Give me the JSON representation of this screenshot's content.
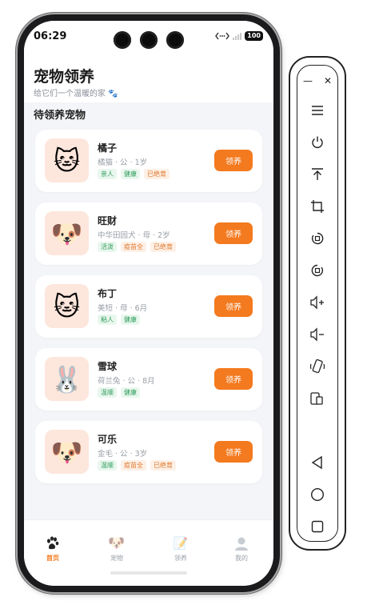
{
  "status": {
    "time": "06:29",
    "battery": "100"
  },
  "header": {
    "title": "宠物领养",
    "subtitle": "给它们一个温暖的家 🐾"
  },
  "section": {
    "title": "待领养宠物"
  },
  "pets": [
    {
      "name": "橘子",
      "info": "橘猫 · 公 · 1岁",
      "emoji": "🐱",
      "tags": [
        "亲人",
        "健康",
        "已绝育"
      ]
    },
    {
      "name": "旺财",
      "info": "中华田园犬 · 母 · 2岁",
      "emoji": "🐶",
      "tags": [
        "活泼",
        "疫苗全",
        "已绝育"
      ]
    },
    {
      "name": "布丁",
      "info": "美短 · 母 · 6月",
      "emoji": "🐱",
      "tags": [
        "粘人",
        "健康"
      ]
    },
    {
      "name": "雪球",
      "info": "荷兰兔 · 公 · 8月",
      "emoji": "🐰",
      "tags": [
        "温顺",
        "健康"
      ]
    },
    {
      "name": "可乐",
      "info": "金毛 · 公 · 3岁",
      "emoji": "🐶",
      "tags": [
        "温顺",
        "疫苗全",
        "已绝育"
      ]
    }
  ],
  "adopt_label": "领养",
  "tabs": [
    {
      "label": "首页",
      "icon": "paw-icon"
    },
    {
      "label": "宠物",
      "icon": "dog-face-icon"
    },
    {
      "label": "领养",
      "icon": "memo-icon"
    },
    {
      "label": "我的",
      "icon": "user-icon"
    }
  ],
  "colors": {
    "accent": "#f47a1f",
    "tag_green": "#2d9c5a",
    "tag_orange": "#e0782c"
  },
  "toolbar": {
    "items": [
      "minimize-icon",
      "close-icon",
      "menu-icon",
      "power-icon",
      "upload-icon",
      "crop-icon",
      "rotate-left-icon",
      "rotate-right-icon",
      "volume-up-icon",
      "volume-down-icon",
      "shake-icon",
      "multi-device-icon",
      "back-icon",
      "home-icon",
      "recents-icon"
    ]
  }
}
